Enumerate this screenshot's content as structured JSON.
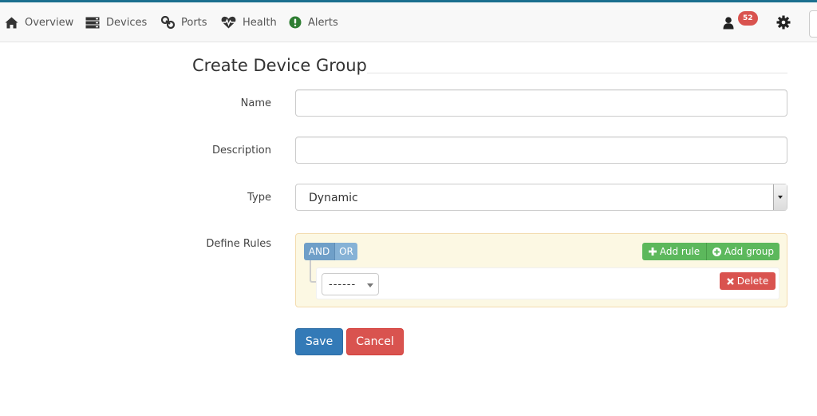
{
  "nav": {
    "items": [
      {
        "label": "Overview",
        "icon": "home-icon"
      },
      {
        "label": "Devices",
        "icon": "server-icon"
      },
      {
        "label": "Ports",
        "icon": "link-icon"
      },
      {
        "label": "Health",
        "icon": "heartbeat-icon"
      },
      {
        "label": "Alerts",
        "icon": "exclamation-circle-icon"
      }
    ],
    "user_badge_count": "52",
    "user_icon": "user-icon",
    "settings_icon": "gear-icon"
  },
  "page": {
    "title": "Create Device Group"
  },
  "form": {
    "name_label": "Name",
    "name_value": "",
    "description_label": "Description",
    "description_value": "",
    "type_label": "Type",
    "type_value": "Dynamic",
    "rules_label": "Define Rules"
  },
  "rules": {
    "and_label": "AND",
    "or_label": "OR",
    "add_rule_label": "Add rule",
    "add_group_label": "Add group",
    "filter_value": "------",
    "delete_label": "Delete"
  },
  "actions": {
    "save_label": "Save",
    "cancel_label": "Cancel"
  },
  "colors": {
    "primary": "#337ab7",
    "danger": "#d9534f",
    "success": "#5cb85c",
    "rules_bg": "#fcf8e3",
    "and_or": "#6f9fc8"
  }
}
